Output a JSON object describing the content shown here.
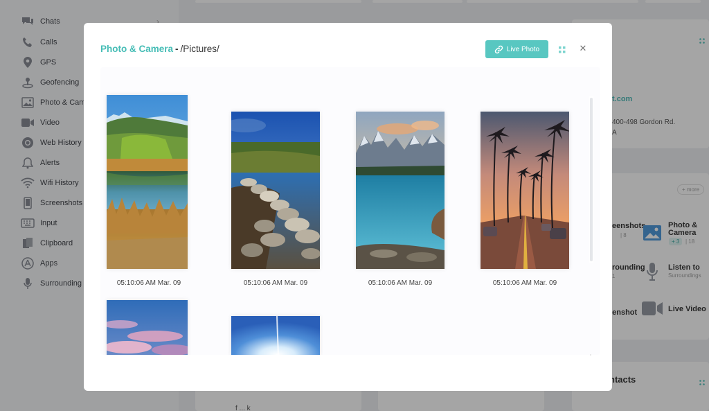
{
  "sidebar": {
    "items": [
      {
        "label": "Chats",
        "icon": "chat-icon"
      },
      {
        "label": "Calls",
        "icon": "phone-icon"
      },
      {
        "label": "GPS",
        "icon": "location-pin-icon"
      },
      {
        "label": "Geofencing",
        "icon": "geofence-icon"
      },
      {
        "label": "Photo & Cam",
        "icon": "image-icon"
      },
      {
        "label": "Video",
        "icon": "video-icon"
      },
      {
        "label": "Web History",
        "icon": "chrome-icon"
      },
      {
        "label": "Alerts",
        "icon": "bell-icon"
      },
      {
        "label": "Wifi History",
        "icon": "wifi-icon"
      },
      {
        "label": "Screenshots",
        "icon": "phone-screen-icon"
      },
      {
        "label": "Input",
        "icon": "keyboard-icon"
      },
      {
        "label": "Clipboard",
        "icon": "clipboard-icon"
      },
      {
        "label": "Apps",
        "icon": "apps-icon"
      },
      {
        "label": "Surrounding",
        "icon": "microphone-icon"
      }
    ]
  },
  "background": {
    "email_fragment": "t.com",
    "address_line1": "400-498 Gordon Rd.",
    "address_line2": "A",
    "more_label": "+ more",
    "screenshots_label": "eenshots",
    "screenshots_count": "| 8",
    "photo_camera_label": "Photo &",
    "photo_camera_label2": "Camera",
    "photo_camera_badge": "+ 3",
    "photo_camera_count": "| 18",
    "surrounding_label": "rounding",
    "surrounding_sub": "1",
    "listen_label": "Listen to",
    "listen_sub": "Surroundings",
    "live_screenshot_label": "e",
    "live_screenshot_label2": "eenshot",
    "live_video_label": "Live Video",
    "contacts_label": "ntacts",
    "bottom_fragment": "f ... k"
  },
  "modal": {
    "title_section": "Photo & Camera",
    "title_separator": "-",
    "title_path": "/Pictures/",
    "live_photo_label": "Live Photo",
    "photos": [
      {
        "caption": "05:10:06 AM Mar. 09",
        "scene": "mountain-lake"
      },
      {
        "caption": "05:10:06 AM Mar. 09",
        "scene": "stone-path"
      },
      {
        "caption": "05:10:06 AM Mar. 09",
        "scene": "glacier-lake"
      },
      {
        "caption": "05:10:06 AM Mar. 09",
        "scene": "palm-road"
      },
      {
        "caption": "",
        "scene": "pink-sky"
      },
      {
        "caption": "",
        "scene": "sun-burst"
      }
    ]
  },
  "colors": {
    "accent": "#46bdb6",
    "button": "#58c7c1"
  }
}
